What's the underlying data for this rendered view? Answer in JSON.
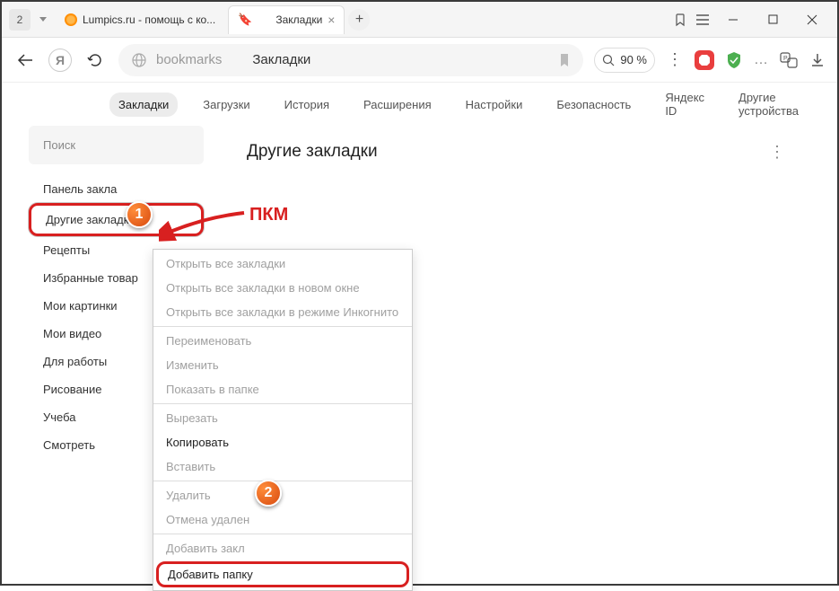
{
  "titlebar": {
    "tab_count": "2",
    "tab1_title": "Lumpics.ru - помощь с кo...",
    "tab2_title": "Закладки"
  },
  "toolbar": {
    "address_protocol": "bookmarks",
    "address_title": "Закладки",
    "zoom": "90 %"
  },
  "nav": {
    "items": [
      "Закладки",
      "Загрузки",
      "История",
      "Расширения",
      "Настройки",
      "Безопасность",
      "Яндекс ID",
      "Другие устройства"
    ]
  },
  "sidebar": {
    "search_placeholder": "Поиск",
    "folders": [
      "Панель заклa",
      "Другие закладки",
      "Рецепты",
      "Избранные товар",
      "Мои картинки",
      "Мои видео",
      "Для работы",
      "Рисование",
      "Учеба",
      "Смотреть"
    ]
  },
  "main": {
    "title": "Другие закладки"
  },
  "context_menu": {
    "g1": [
      "Открыть все закладки",
      "Открыть все закладки в новом окне",
      "Открыть все закладки в режиме Инкогнито"
    ],
    "g2": [
      "Переименовать",
      "Изменить",
      "Показать в папке"
    ],
    "g3": [
      "Вырезать",
      "Копировать",
      "Вставить"
    ],
    "g4": [
      "Удалить",
      "Отмена удален"
    ],
    "g5": [
      "Добавить закл",
      "Добавить папку"
    ]
  },
  "annotations": {
    "badge1": "1",
    "badge2": "2",
    "pkm": "ПКМ"
  }
}
